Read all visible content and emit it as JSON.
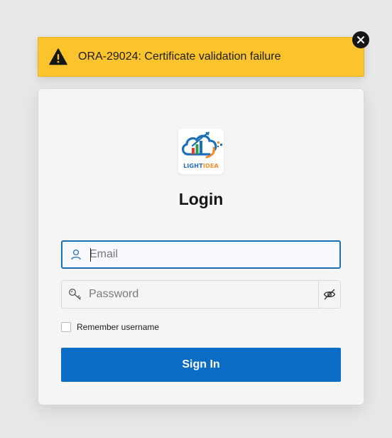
{
  "alert": {
    "message": "ORA-29024: Certificate validation failure",
    "icon": "warning-icon",
    "close_icon": "close-icon",
    "background": "#fcc42c"
  },
  "login": {
    "logo": {
      "text_light": "LIGHT",
      "text_idea": "IDEA"
    },
    "title": "Login",
    "email": {
      "placeholder": "Email",
      "value": "",
      "icon": "user-icon"
    },
    "password": {
      "placeholder": "Password",
      "value": "",
      "icon": "key-icon",
      "toggle_icon": "eye-slash-icon"
    },
    "remember": {
      "label": "Remember username",
      "checked": false
    },
    "signin_label": "Sign In",
    "accent": "#0b6cc6"
  }
}
